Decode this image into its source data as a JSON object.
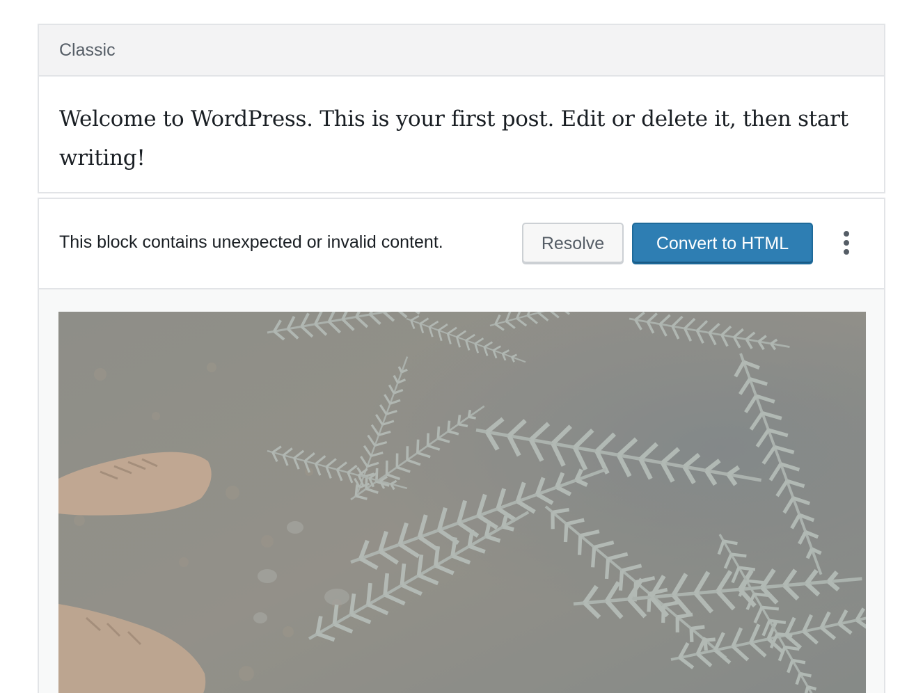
{
  "classic_block": {
    "label": "Classic",
    "content": "Welcome to WordPress. This is your first post. Edit or delete it, then start writing!"
  },
  "invalid_block": {
    "warning": "This block contains unexpected or invalid content.",
    "resolve_label": "Resolve",
    "convert_label": "Convert to HTML",
    "more_icon": "more-vertical-icon"
  },
  "image": {
    "icon": "forest-fern-photo"
  },
  "colors": {
    "primary_button": "#2e7eb3",
    "border": "#e2e4e7",
    "toolbar_bg": "#f3f3f4"
  }
}
